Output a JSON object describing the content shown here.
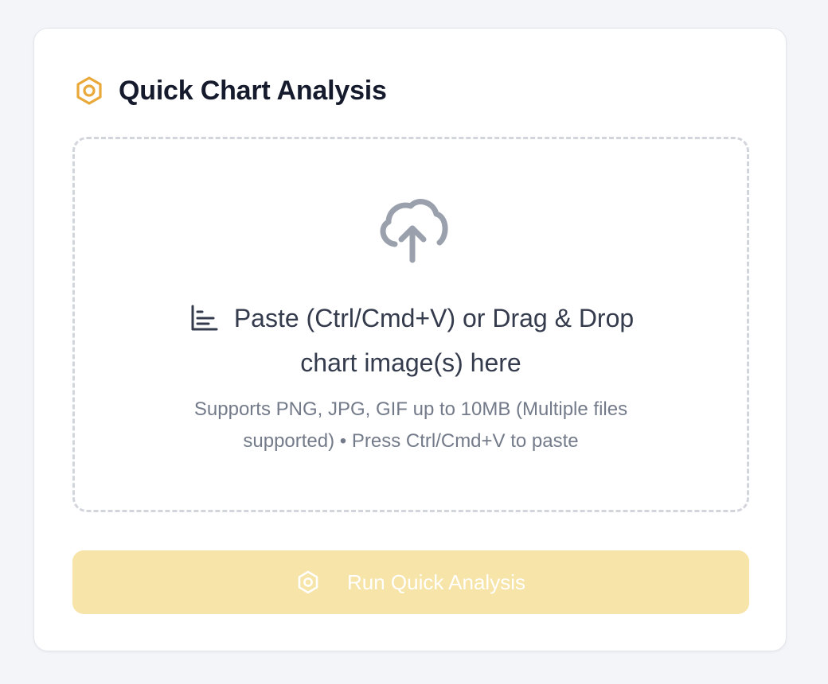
{
  "card": {
    "title": "Quick Chart Analysis",
    "title_icon": "hexagon-gear-icon"
  },
  "dropzone": {
    "icon": "cloud-upload-icon",
    "chart_icon": "bar-chart-icon",
    "primary_line1": "Paste (Ctrl/Cmd+V) or Drag & Drop",
    "primary_line2": "chart image(s) here",
    "secondary_line1": "Supports PNG, JPG, GIF up to 10MB (Multiple files",
    "secondary_line2": "supported) • Press Ctrl/Cmd+V to paste"
  },
  "run_button": {
    "label": "Run Quick Analysis",
    "icon": "hexagon-gear-icon",
    "state": "disabled"
  },
  "colors": {
    "accent": "#e9a93a",
    "button_bg_disabled": "#f6e4a8",
    "title_text": "#151b2c",
    "body_text": "#343b4c",
    "muted_text": "#737a89",
    "icon_gray": "#9aa1ad",
    "border_dashed": "#d3d5dc"
  }
}
